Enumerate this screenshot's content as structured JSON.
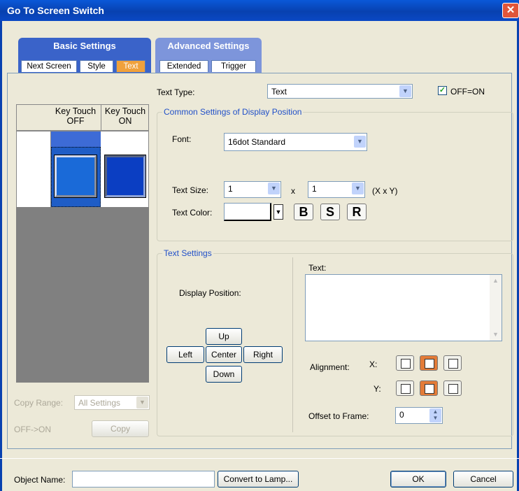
{
  "window": {
    "title": "Go To Screen Switch"
  },
  "tabs": {
    "basic_group": "Basic Settings",
    "advanced_group": "Advanced Settings",
    "basic": [
      "Next Screen",
      "Style",
      "Text"
    ],
    "advanced": [
      "Extended",
      "Trigger"
    ],
    "active": "Text"
  },
  "preview": {
    "col_off": "Key Touch\nOFF",
    "col_on": "Key Touch\nON"
  },
  "copy": {
    "range_label": "Copy Range:",
    "range_value": "All Settings",
    "off_on_label": "OFF->ON",
    "copy_button": "Copy"
  },
  "text_type": {
    "label": "Text Type:",
    "value": "Text",
    "off_on_checkbox": "OFF=ON",
    "checked": true
  },
  "common": {
    "legend": "Common Settings of Display Position",
    "font_label": "Font:",
    "font_value": "16dot Standard",
    "size_label": "Text Size:",
    "size_x": "1",
    "size_sep": "x",
    "size_y": "1",
    "size_unit": "(X x Y)",
    "color_label": "Text Color:",
    "color_value": "#ffffff",
    "bold": "B",
    "shadow": "S",
    "reverse": "R"
  },
  "text_settings": {
    "legend": "Text Settings",
    "display_position_label": "Display Position:",
    "up": "Up",
    "left": "Left",
    "center": "Center",
    "right": "Right",
    "down": "Down",
    "text_label": "Text:",
    "text_value": "",
    "alignment_label": "Alignment:",
    "x_label": "X:",
    "y_label": "Y:",
    "x_selected": "center",
    "y_selected": "center",
    "offset_label": "Offset to Frame:",
    "offset_value": "0"
  },
  "footer": {
    "object_name_label": "Object Name:",
    "object_name_value": "",
    "convert_button": "Convert to Lamp...",
    "ok_button": "OK",
    "cancel_button": "Cancel"
  },
  "colors": {
    "title_blue": "#0841b0",
    "active_tab": "#f0a13c",
    "switch_blue": "#1a5fd1",
    "accent_orange": "#e37b37"
  }
}
